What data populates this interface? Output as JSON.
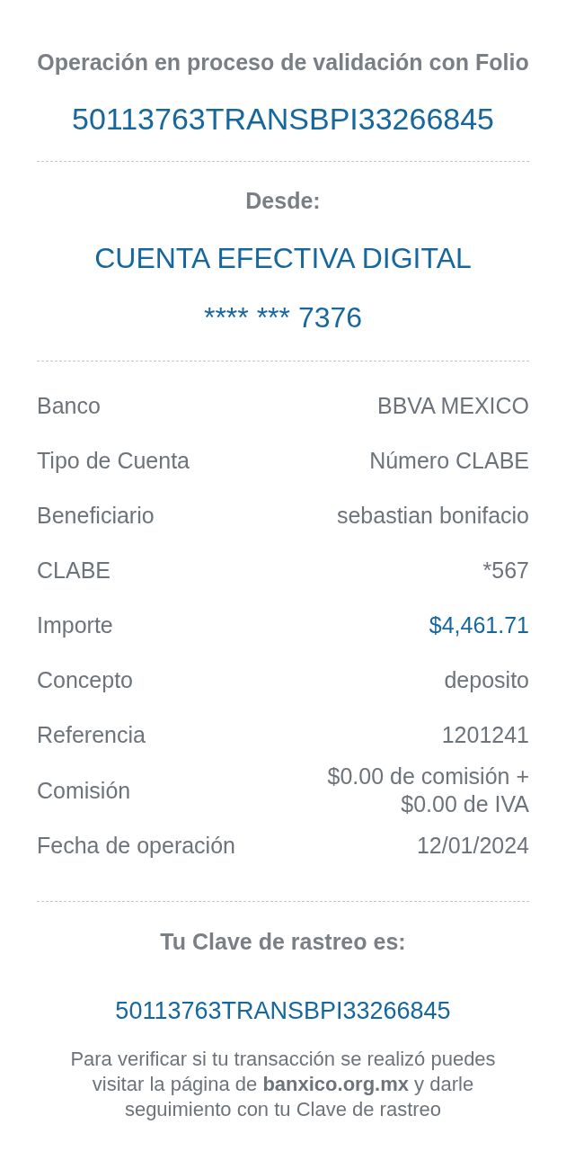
{
  "header": {
    "title": "Operación en proceso de validación con Folio",
    "folio": "50113763TRANSBPI33266845"
  },
  "origin": {
    "label": "Desde:",
    "account_name": "CUENTA EFECTIVA DIGITAL",
    "account_number": "**** *** 7376"
  },
  "details": [
    {
      "label": "Banco",
      "value": "BBVA MEXICO",
      "kind": "text"
    },
    {
      "label": "Tipo de Cuenta",
      "value": "Número CLABE",
      "kind": "text"
    },
    {
      "label": "Beneficiario",
      "value": "sebastian bonifacio",
      "kind": "text"
    },
    {
      "label": "CLABE",
      "value": "*567",
      "kind": "text"
    },
    {
      "label": "Importe",
      "value": "$4,461.71",
      "kind": "amount"
    },
    {
      "label": "Concepto",
      "value": "deposito",
      "kind": "text"
    },
    {
      "label": "Referencia",
      "value": "1201241",
      "kind": "text"
    },
    {
      "label": "Comisión",
      "value": "$0.00 de comisión + $0.00 de IVA",
      "kind": "text"
    },
    {
      "label": "Fecha de operación",
      "value": "12/01/2024",
      "kind": "text"
    }
  ],
  "tracking": {
    "label": "Tu Clave de rastreo es:",
    "code": "50113763TRANSBPI33266845",
    "note": "Para verificar si tu transacción se realizó puedes visitar la página de **banxico.org.mx** y darle seguimiento con tu Clave de rastreo"
  }
}
